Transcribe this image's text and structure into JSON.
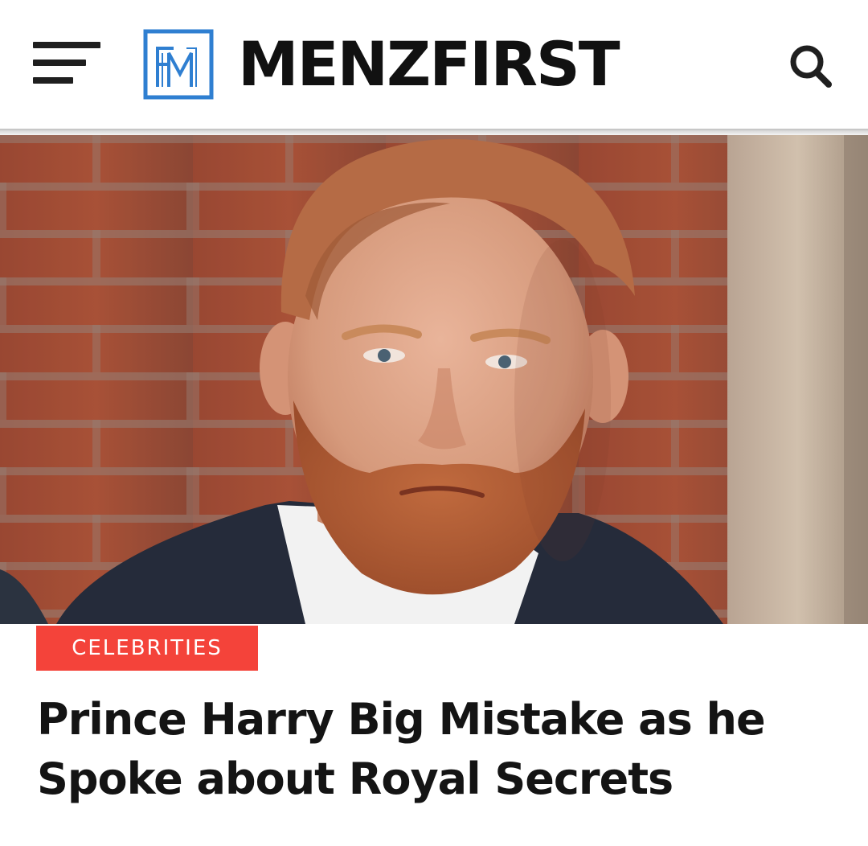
{
  "header": {
    "brand_name": "MENZFIRST",
    "logo_monogram": "FM",
    "menu_icon": "hamburger-menu-icon",
    "search_icon": "search-icon",
    "accent_color": "#2f7fd1"
  },
  "hero": {
    "image": "portrait photo of a red-bearded man in a dark suit in front of a brick wall"
  },
  "article": {
    "category": "CELEBRITIES",
    "category_color": "#f4433a",
    "title": "Prince Harry Big Mistake as he Spoke about Royal Secrets"
  }
}
